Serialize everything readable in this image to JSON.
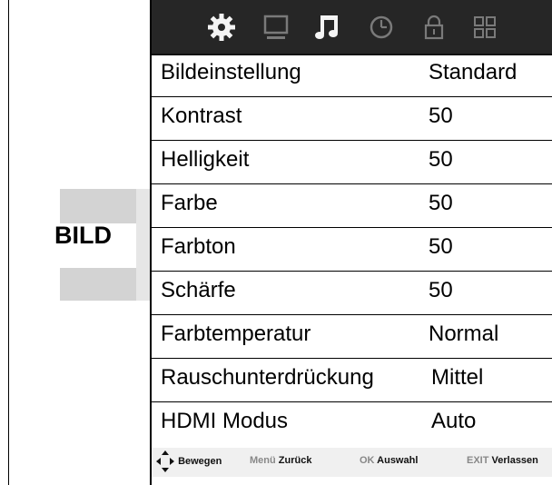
{
  "side": {
    "title": "BILD"
  },
  "topbar": {
    "icons": [
      "gear-icon",
      "monitor-icon",
      "music-note-icon",
      "clock-icon",
      "lock-icon",
      "grid-icon"
    ],
    "active_color": "#f4f4f4",
    "inactive_color": "#7a7a7a"
  },
  "menu": {
    "rows": [
      {
        "label": "Bildeinstellung",
        "value": "Standard"
      },
      {
        "label": "Kontrast",
        "value": "50"
      },
      {
        "label": "Helligkeit",
        "value": "50"
      },
      {
        "label": "Farbe",
        "value": "50"
      },
      {
        "label": "Farbton",
        "value": "50"
      },
      {
        "label": "Schärfe",
        "value": "50"
      },
      {
        "label": "Farbtemperatur",
        "value": "Normal"
      },
      {
        "label": "Rauschunterdrückung",
        "value": "Mittel"
      },
      {
        "label": "HDMI Modus",
        "value": "Auto"
      }
    ]
  },
  "footer": {
    "move_label": "Bewegen",
    "menu_key": "Menü",
    "back_label": "Zurück",
    "ok_key": "OK",
    "select_label": "Auswahl",
    "exit_key": "EXIT",
    "exit_label": "Verlassen"
  }
}
